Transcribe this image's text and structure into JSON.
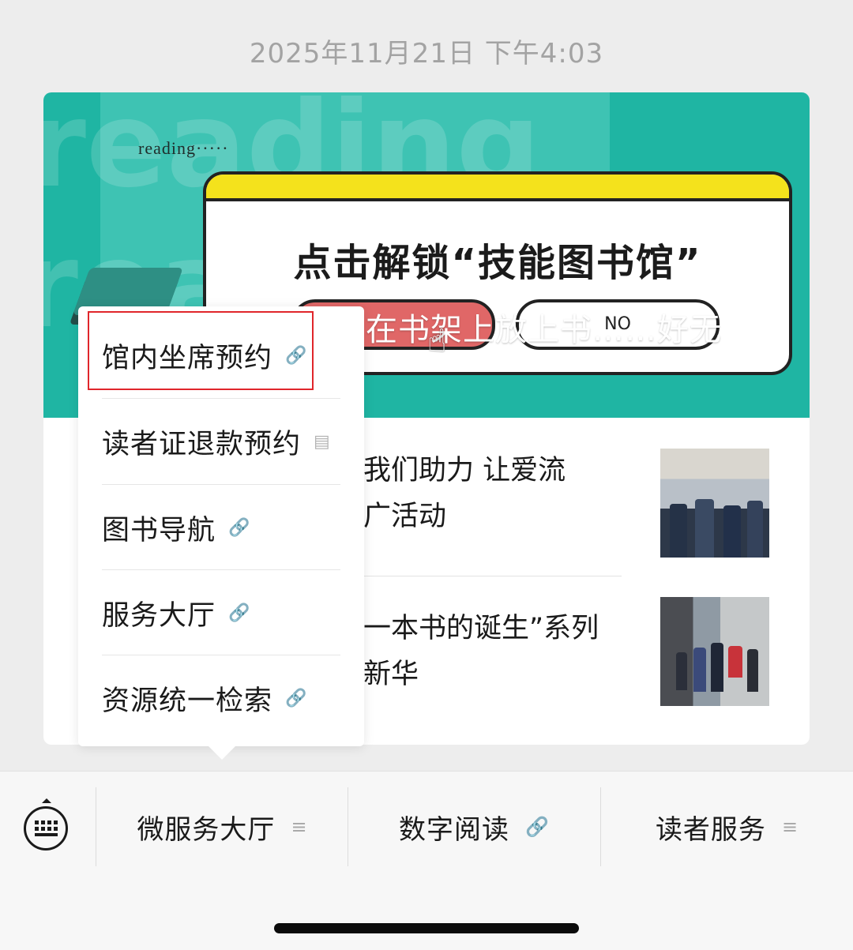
{
  "status": {
    "timestamp": "2025年11月21日 下午4:03"
  },
  "banner": {
    "bg_word": "reading",
    "small_text": "reading·····",
    "headline": "点击解锁“技能图书馆”",
    "no_button": "NO",
    "overlay_text": "在书架上放上书……好无"
  },
  "articles": [
    {
      "title_line1": "我们助力 让爱流",
      "title_line2": "广活动"
    },
    {
      "title_line1": "一本书的诞生”系列",
      "title_line2": "新华"
    }
  ],
  "menu": {
    "items": [
      {
        "label": "馆内坐席预约",
        "icon": "link-icon"
      },
      {
        "label": "读者证退款预约",
        "icon": "article-icon"
      },
      {
        "label": "图书导航",
        "icon": "link-icon"
      },
      {
        "label": "服务大厅",
        "icon": "link-icon"
      },
      {
        "label": "资源统一检索",
        "icon": "link-icon"
      }
    ],
    "highlight_color": "#e0262b"
  },
  "bottom_bar": {
    "tabs": [
      {
        "label": "微服务大厅",
        "icon": "menu-icon"
      },
      {
        "label": "数字阅读",
        "icon": "link-icon"
      },
      {
        "label": "读者服务",
        "icon": "menu-icon"
      }
    ]
  }
}
